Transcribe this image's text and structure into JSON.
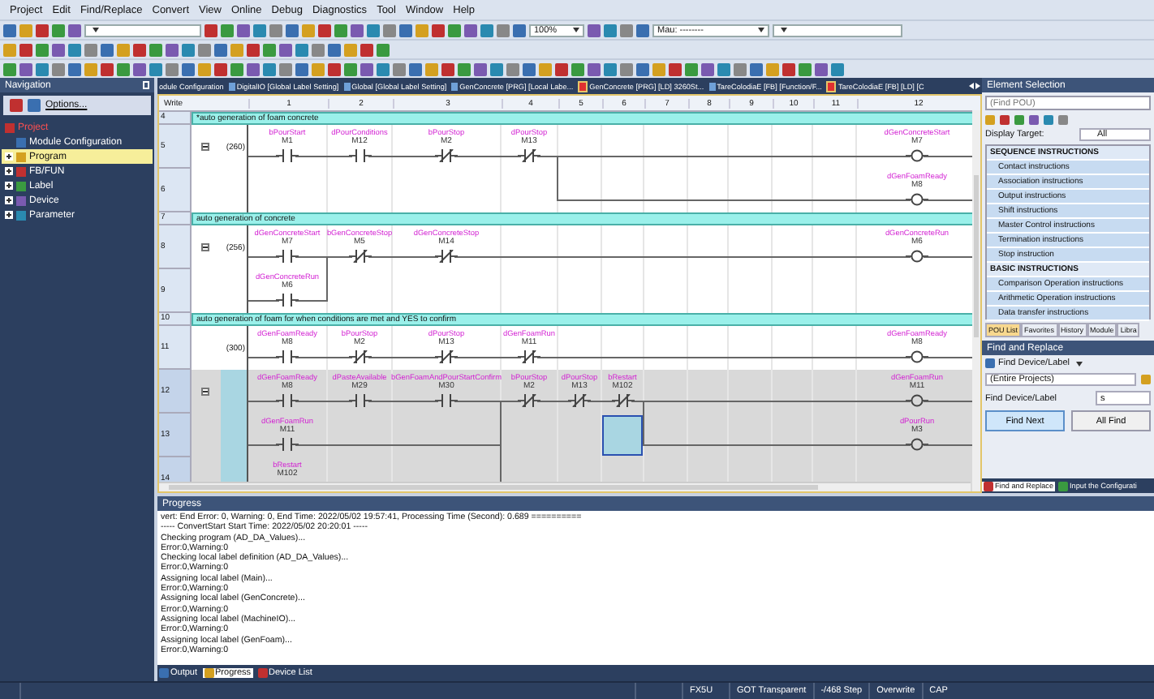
{
  "menu": [
    "Project",
    "Edit",
    "Find/Replace",
    "Convert",
    "View",
    "Online",
    "Debug",
    "Diagnostics",
    "Tool",
    "Window",
    "Help"
  ],
  "toolbar": {
    "zoom": "100%",
    "station": "Mau: --------"
  },
  "navigation": {
    "title": "Navigation",
    "options": "Options...",
    "tree": [
      {
        "label": "Project",
        "selected": false,
        "children": [
          {
            "label": "Module Configuration",
            "selected": false
          },
          {
            "label": "Program",
            "selected": true,
            "expanded": false
          },
          {
            "label": "FB/FUN",
            "selected": false,
            "expanded": false
          },
          {
            "label": "Label",
            "selected": false,
            "expanded": false
          },
          {
            "label": "Device",
            "selected": false,
            "expanded": false
          },
          {
            "label": "Parameter",
            "selected": false,
            "expanded": false
          }
        ]
      }
    ]
  },
  "doc_tabs": [
    {
      "label": "odule Configuration",
      "kind": "plain"
    },
    {
      "label": "DigitalIO [Global Label Setting]",
      "kind": "label"
    },
    {
      "label": "Global [Global Label Setting]",
      "kind": "label"
    },
    {
      "label": "GenConcrete [PRG] [Local Labe...",
      "kind": "label"
    },
    {
      "label": "GenConcrete [PRG] [LD] 3260St...",
      "kind": "ladder"
    },
    {
      "label": "TareColodiaE [FB] [Function/F...",
      "kind": "label"
    },
    {
      "label": "TareColodiaE [FB] [LD] [C",
      "kind": "ladder"
    }
  ],
  "ladder": {
    "mode": "Write",
    "columns": [
      "1",
      "2",
      "3",
      "4",
      "5",
      "6",
      "7",
      "8",
      "9",
      "10",
      "11",
      "12"
    ],
    "rows": [
      {
        "number": "4",
        "kind": "comment",
        "selected": false,
        "comment": "*auto generation of foam concrete"
      },
      {
        "number": "5",
        "kind": "rung",
        "selected": false,
        "expanded": true,
        "step": "(260)",
        "cells": [
          {
            "kind": "no",
            "label": "bPourStart",
            "device": "M1"
          },
          {
            "kind": "no",
            "label": "dPourConditions",
            "device": "M12"
          },
          {
            "kind": "nc",
            "label": "bPourStop",
            "device": "M2"
          },
          {
            "kind": "nc",
            "label": "dPourStop",
            "device": "M13"
          },
          {
            "kind": "wire"
          },
          {
            "kind": "wire"
          },
          {
            "kind": "wire"
          },
          {
            "kind": "wire"
          },
          {
            "kind": "wire"
          },
          {
            "kind": "wire"
          },
          {
            "kind": "wire"
          },
          {
            "kind": "coil",
            "label": "dGenConcreteStart",
            "device": "M7"
          }
        ]
      },
      {
        "number": "6",
        "kind": "rung",
        "selected": false,
        "cells": [
          {
            "kind": "empty"
          },
          {
            "kind": "empty"
          },
          {
            "kind": "empty"
          },
          {
            "kind": "empty"
          },
          {
            "kind": "wire_branch"
          },
          {
            "kind": "wire"
          },
          {
            "kind": "wire"
          },
          {
            "kind": "wire"
          },
          {
            "kind": "wire"
          },
          {
            "kind": "wire"
          },
          {
            "kind": "wire"
          },
          {
            "kind": "coil",
            "label": "dGenFoamReady",
            "device": "M8"
          }
        ]
      },
      {
        "number": "7",
        "kind": "comment",
        "selected": false,
        "comment": "auto generation of concrete"
      },
      {
        "number": "8",
        "kind": "rung",
        "selected": false,
        "expanded": true,
        "step": "(256)",
        "cells": [
          {
            "kind": "no",
            "label": "dGenConcreteStart",
            "device": "M7"
          },
          {
            "kind": "nc",
            "label": "bGenConcreteStop",
            "device": "M5"
          },
          {
            "kind": "nc",
            "label": "dGenConcreteStop",
            "device": "M14"
          },
          {
            "kind": "wire"
          },
          {
            "kind": "wire"
          },
          {
            "kind": "wire"
          },
          {
            "kind": "wire"
          },
          {
            "kind": "wire"
          },
          {
            "kind": "wire"
          },
          {
            "kind": "wire"
          },
          {
            "kind": "wire"
          },
          {
            "kind": "coil",
            "label": "dGenConcreteRun",
            "device": "M6"
          }
        ]
      },
      {
        "number": "9",
        "kind": "rung",
        "selected": false,
        "cells": [
          {
            "kind": "no",
            "label": "dGenConcreteRun",
            "device": "M6"
          },
          {
            "kind": "branch"
          },
          {
            "kind": "empty"
          },
          {
            "kind": "empty"
          },
          {
            "kind": "empty"
          },
          {
            "kind": "empty"
          },
          {
            "kind": "empty"
          },
          {
            "kind": "empty"
          },
          {
            "kind": "empty"
          },
          {
            "kind": "empty"
          },
          {
            "kind": "empty"
          },
          {
            "kind": "empty"
          }
        ]
      },
      {
        "number": "10",
        "kind": "comment",
        "selected": false,
        "comment": "auto generation of foam for when conditions are met and YES to confirm"
      },
      {
        "number": "11",
        "kind": "rung",
        "selected": false,
        "step": "(300)",
        "cells": [
          {
            "kind": "no",
            "label": "dGenFoamReady",
            "device": "M8"
          },
          {
            "kind": "nc",
            "label": "bPourStop",
            "device": "M2"
          },
          {
            "kind": "nc",
            "label": "dPourStop",
            "device": "M13"
          },
          {
            "kind": "nc",
            "label": "dGenFoamRun",
            "device": "M11"
          },
          {
            "kind": "wire"
          },
          {
            "kind": "wire"
          },
          {
            "kind": "wire"
          },
          {
            "kind": "wire"
          },
          {
            "kind": "wire"
          },
          {
            "kind": "wire"
          },
          {
            "kind": "wire"
          },
          {
            "kind": "coil",
            "label": "dGenFoamReady",
            "device": "M8"
          }
        ]
      },
      {
        "number": "12",
        "kind": "rung",
        "selected": true,
        "expanded": true,
        "cells": [
          {
            "kind": "no",
            "label": "dGenFoamReady",
            "device": "M8"
          },
          {
            "kind": "no",
            "label": "dPasteAvailable",
            "device": "M29"
          },
          {
            "kind": "no",
            "label": "bGenFoamAndPourStartConfirm",
            "device": "M30"
          },
          {
            "kind": "nc",
            "label": "bPourStop",
            "device": "M2"
          },
          {
            "kind": "nc",
            "label": "dPourStop",
            "device": "M13"
          },
          {
            "kind": "nc",
            "label": "bRestart",
            "device": "M102"
          },
          {
            "kind": "wire"
          },
          {
            "kind": "wire"
          },
          {
            "kind": "wire"
          },
          {
            "kind": "wire"
          },
          {
            "kind": "wire"
          },
          {
            "kind": "coil",
            "label": "dGenFoamRun",
            "device": "M11"
          }
        ]
      },
      {
        "number": "13",
        "kind": "rung",
        "selected": true,
        "cells": [
          {
            "kind": "no",
            "label": "dGenFoamRun",
            "device": "M11"
          },
          {
            "kind": "wire"
          },
          {
            "kind": "wire"
          },
          {
            "kind": "branch"
          },
          {
            "kind": "empty"
          },
          {
            "kind": "cursor"
          },
          {
            "kind": "wire_branch"
          },
          {
            "kind": "wire"
          },
          {
            "kind": "wire"
          },
          {
            "kind": "wire"
          },
          {
            "kind": "wire"
          },
          {
            "kind": "coil",
            "label": "dPourRun",
            "device": "M3"
          }
        ]
      },
      {
        "number": "14",
        "kind": "rung",
        "selected": true,
        "cells": [
          {
            "kind": "no",
            "label": "bRestart",
            "device": "M102"
          },
          {
            "kind": "empty"
          },
          {
            "kind": "empty"
          },
          {
            "kind": "branch"
          },
          {
            "kind": "empty"
          },
          {
            "kind": "empty"
          },
          {
            "kind": "empty"
          },
          {
            "kind": "empty"
          },
          {
            "kind": "empty"
          },
          {
            "kind": "empty"
          },
          {
            "kind": "empty"
          },
          {
            "kind": "empty"
          }
        ]
      }
    ]
  },
  "element_selection": {
    "title": "Element Selection",
    "search_placeholder": "(Find POU)",
    "display_target_label": "Display Target:",
    "display_target": "All",
    "items": [
      {
        "kind": "category",
        "label": "SEQUENCE INSTRUCTIONS"
      },
      {
        "kind": "item",
        "label": "Contact instructions"
      },
      {
        "kind": "item",
        "label": "Association instructions"
      },
      {
        "kind": "item",
        "label": "Output instructions"
      },
      {
        "kind": "item",
        "label": "Shift instructions"
      },
      {
        "kind": "item",
        "label": "Master Control instructions"
      },
      {
        "kind": "item",
        "label": "Termination instructions"
      },
      {
        "kind": "item",
        "label": "Stop instruction"
      },
      {
        "kind": "category",
        "label": "BASIC INSTRUCTIONS"
      },
      {
        "kind": "item",
        "label": "Comparison Operation instructions"
      },
      {
        "kind": "item",
        "label": "Arithmetic Operation instructions"
      },
      {
        "kind": "item",
        "label": "Data transfer instructions"
      }
    ],
    "tabs": [
      {
        "label": "POU List",
        "selected": true
      },
      {
        "label": "Favorites",
        "selected": false
      },
      {
        "label": "History",
        "selected": false
      },
      {
        "label": "Module",
        "selected": false
      },
      {
        "label": "Libra",
        "selected": false
      }
    ]
  },
  "find_replace": {
    "title": "Find and Replace",
    "mode_button": "Find Device/Label",
    "scope": "(Entire Projects)",
    "field_label": "Find Device/Label",
    "field_value": "s",
    "buttons": [
      "Find Next",
      "All Find"
    ],
    "tabs": [
      {
        "label": "Find and Replace",
        "selected": true
      },
      {
        "label": "Input the Configurati",
        "selected": false
      }
    ]
  },
  "progress": {
    "title": "Progress",
    "lines": [
      "vert: End  Error: 0, Warning: 0, End Time: 2022/05/02 19:57:41, Processing Time (Second):  0.689 ==========",
      "----- ConvertStart  Start Time: 2022/05/02 20:20:01 -----",
      "Checking program (AD_DA_Values)...",
      "Error:0,Warning:0",
      "Checking local label definition (AD_DA_Values)...",
      "Error:0,Warning:0",
      "Assigning local label (Main)...",
      "Error:0,Warning:0",
      "Assigning local label (GenConcrete)...",
      "Error:0,Warning:0",
      "Assigning local label (MachineIO)...",
      "Error:0,Warning:0",
      "Assigning local label (GenFoam)...",
      "Error:0,Warning:0"
    ],
    "tabs": [
      {
        "label": "Output",
        "selected": false
      },
      {
        "label": "Progress",
        "selected": true
      },
      {
        "label": "Device List",
        "selected": false
      }
    ]
  },
  "status_bar": [
    "FX5U",
    "GOT Transparent",
    "-/468 Step",
    "Overwrite",
    "CAP"
  ]
}
